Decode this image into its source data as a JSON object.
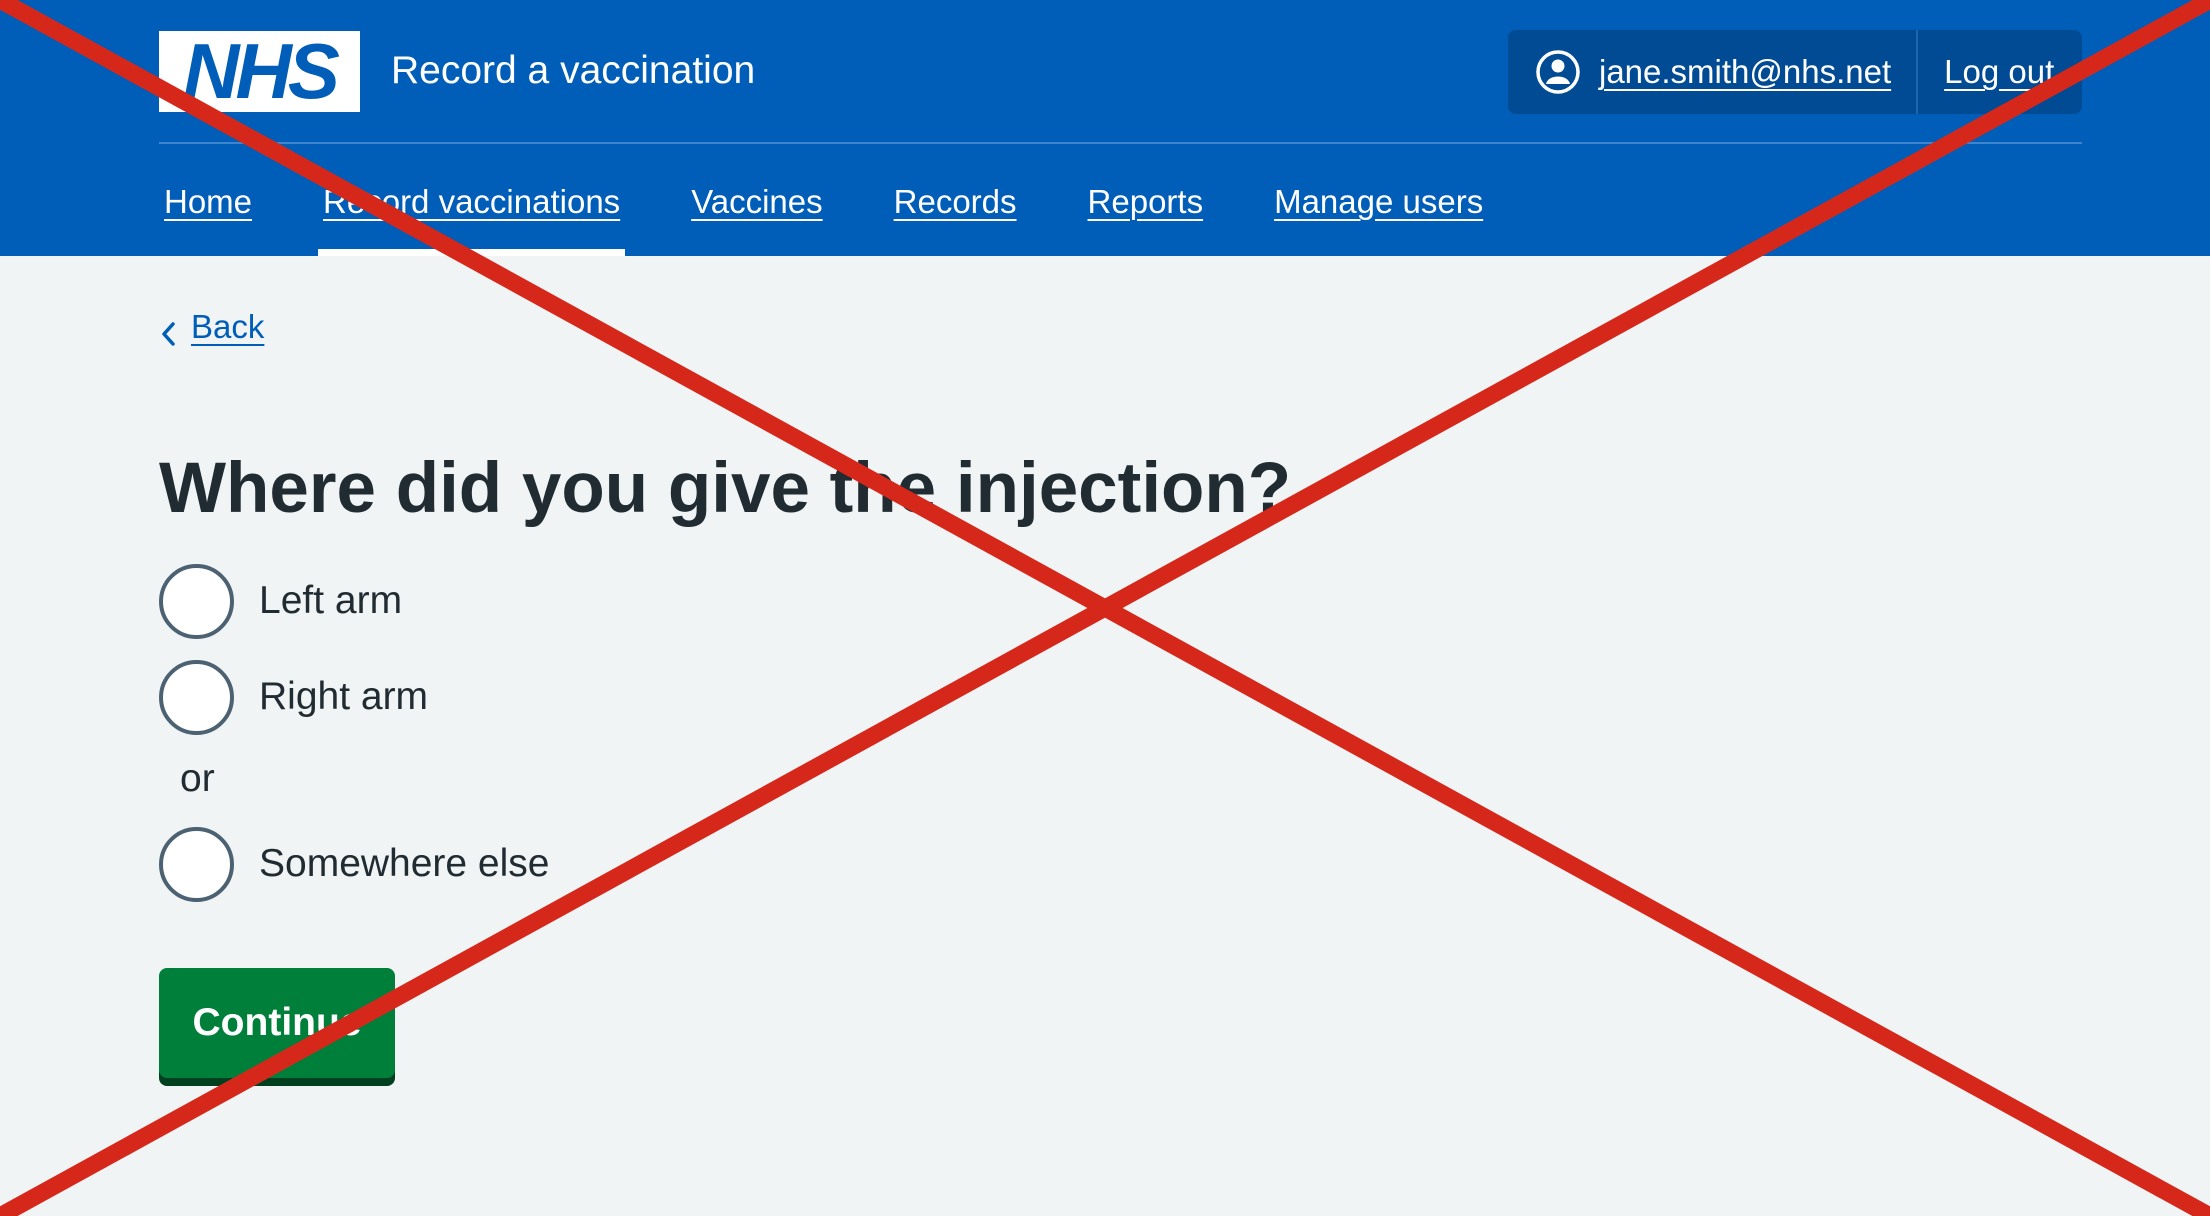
{
  "header": {
    "logo_text": "NHS",
    "service_name": "Record a vaccination",
    "account": {
      "email": "jane.smith@nhs.net",
      "logout_label": "Log out",
      "icon": "user-icon"
    }
  },
  "nav": {
    "items": [
      {
        "label": "Home",
        "active": false
      },
      {
        "label": "Record vaccinations",
        "active": true
      },
      {
        "label": "Vaccines",
        "active": false
      },
      {
        "label": "Records",
        "active": false
      },
      {
        "label": "Reports",
        "active": false
      },
      {
        "label": "Manage users",
        "active": false
      }
    ]
  },
  "back": {
    "label": "Back",
    "icon": "chevron-left-icon"
  },
  "form": {
    "question": "Where did you give the injection?",
    "options": [
      {
        "label": "Left arm",
        "selected": false
      },
      {
        "label": "Right arm",
        "selected": false
      },
      {
        "label": "Somewhere else",
        "selected": false
      }
    ],
    "divider": "or",
    "continue_label": "Continue"
  },
  "overlay": {
    "type": "red-cross",
    "color": "#d5281b"
  },
  "colors": {
    "nhs_blue": "#005eb8",
    "account_bg": "#004b93",
    "page_bg": "#f0f4f5",
    "button_green": "#007f3b",
    "text": "#212b32"
  }
}
